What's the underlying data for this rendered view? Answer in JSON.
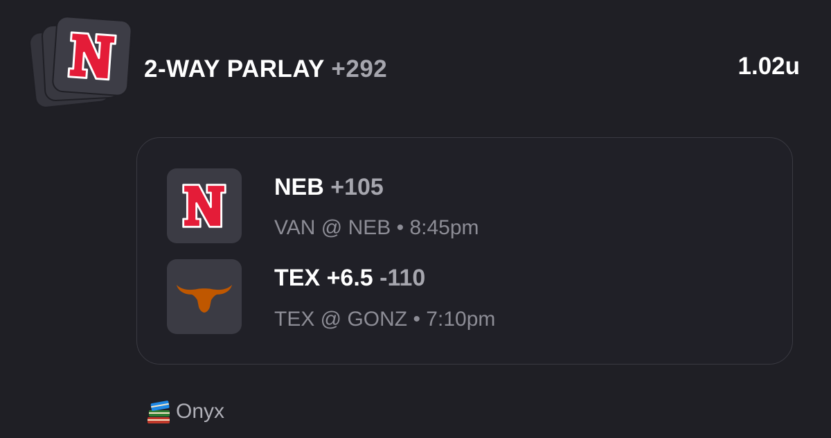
{
  "header": {
    "title": "2-WAY PARLAY",
    "odds": "+292",
    "units": "1.02u"
  },
  "legs": [
    {
      "team_icon": "nebraska-n-logo",
      "pick": "NEB",
      "odds": "+105",
      "matchup": "VAN @ NEB • 8:45pm"
    },
    {
      "team_icon": "texas-longhorn-logo",
      "pick": "TEX +6.5",
      "odds": "-110",
      "matchup": "TEX @ GONZ • 7:10pm"
    }
  ],
  "footer": {
    "icon": "books-emoji",
    "label": "Onyx"
  },
  "colors": {
    "background": "#1f1f25",
    "tile": "#3b3b44",
    "nebraska_red": "#e41c38",
    "texas_orange": "#bf5700",
    "muted_text": "#8d8d96"
  }
}
